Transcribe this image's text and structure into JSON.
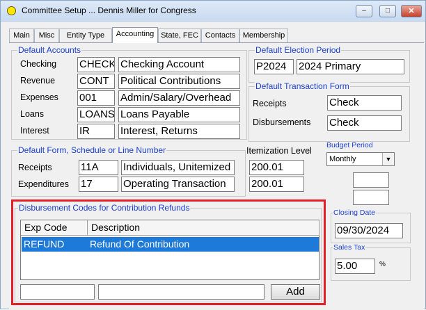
{
  "window": {
    "title": "Committee Setup ... Dennis Miller for Congress",
    "minimize_label": "‒",
    "maximize_label": "□",
    "close_label": "✕"
  },
  "tabs": [
    "Main",
    "Misc",
    "Entity Type",
    "Accounting",
    "State, FEC",
    "Contacts",
    "Membership"
  ],
  "active_tab": "Accounting",
  "default_accounts": {
    "legend": "Default Accounts",
    "rows": [
      {
        "label": "Checking",
        "code": "CHECK",
        "description": "Checking Account"
      },
      {
        "label": "Revenue",
        "code": "CONT",
        "description": "Political Contributions"
      },
      {
        "label": "Expenses",
        "code": "001",
        "description": "Admin/Salary/Overhead"
      },
      {
        "label": "Loans",
        "code": "LOANS",
        "description": "Loans Payable"
      },
      {
        "label": "Interest",
        "code": "IR",
        "description": "Interest, Returns"
      }
    ]
  },
  "default_election_period": {
    "legend": "Default Election Period",
    "code": "P2024",
    "description": "2024 Primary"
  },
  "default_transaction_form": {
    "legend": "Default Transaction Form",
    "receipts_label": "Receipts",
    "receipts_value": "Check",
    "disbursements_label": "Disbursements",
    "disbursements_value": "Check"
  },
  "default_form": {
    "legend": "Default Form, Schedule or Line Number",
    "itemization_label": "Itemization Level",
    "rows": [
      {
        "label": "Receipts",
        "code": "11A",
        "description": "Individuals, Unitemized",
        "itemization": "200.01"
      },
      {
        "label": "Expenditures",
        "code": "17",
        "description": "Operating Transaction",
        "itemization": "200.01"
      }
    ]
  },
  "budget_period": {
    "label": "Budget Period",
    "selected": "Monthly",
    "field1": "",
    "field2": ""
  },
  "closing_date": {
    "legend": "Closing Date",
    "value": "09/30/2024"
  },
  "sales_tax": {
    "legend": "Sales Tax",
    "value": "5.00",
    "unit": "%"
  },
  "disbursement_codes": {
    "legend": "Disbursement Codes for Contribution Refunds",
    "columns": [
      "Exp Code",
      "Description"
    ],
    "rows": [
      {
        "code": "REFUND",
        "description": "Refund Of Contribution"
      }
    ],
    "new_code": "",
    "new_description": "",
    "add_label": "Add"
  },
  "colors": {
    "legend_text": "#1b3fcc",
    "selection": "#1d7ad9",
    "highlight_border": "#e2202a"
  }
}
